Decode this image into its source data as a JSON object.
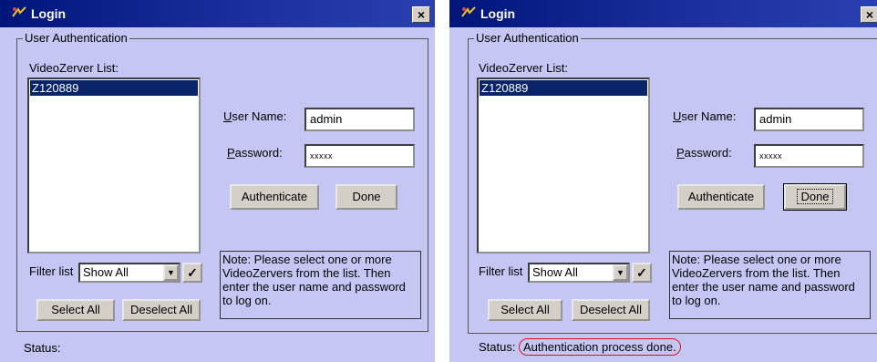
{
  "dialogs": [
    {
      "title": "Login",
      "close_label": "×",
      "group_label": "User Authentication",
      "list_label": "VideoZerver List:",
      "list_items": [
        "Z120889"
      ],
      "username_label_prefix": "U",
      "username_label_rest": "ser Name:",
      "username_value": "admin",
      "password_label_prefix": "P",
      "password_label_rest": "assword:",
      "password_value": "xxxxx",
      "authenticate_label": "Authenticate",
      "done_label": "Done",
      "filter_label": "Filter list",
      "filter_value": "Show All",
      "check_label": "✓",
      "select_all_label": "Select All",
      "deselect_all_label": "Deselect All",
      "note_text": "Note: Please select one or more VideoZervers from the list. Then enter the user name and password to log on.",
      "status_label": "Status:",
      "status_value": ""
    },
    {
      "title": "Login",
      "close_label": "×",
      "group_label": "User Authentication",
      "list_label": "VideoZerver List:",
      "list_items": [
        "Z120889"
      ],
      "username_label_prefix": "U",
      "username_label_rest": "ser Name:",
      "username_value": "admin",
      "password_label_prefix": "P",
      "password_label_rest": "assword:",
      "password_value": "xxxxx",
      "authenticate_label": "Authenticate",
      "done_label": "Done",
      "filter_label": "Filter list",
      "filter_value": "Show All",
      "check_label": "✓",
      "select_all_label": "Select All",
      "deselect_all_label": "Deselect All",
      "note_text": "Note: Please select one or more VideoZervers from the list. Then enter the user name and password to log on.",
      "status_label": "Status:",
      "status_value": "Authentication process done.",
      "status_highlight_color": "#e01010"
    }
  ],
  "colors": {
    "titlebar": "#00157a",
    "dialog_bg": "#c6c6f4",
    "selection": "#0a246a"
  }
}
